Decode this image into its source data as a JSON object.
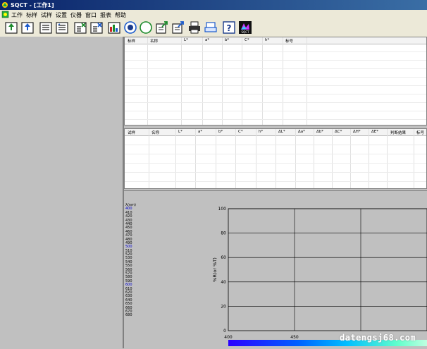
{
  "window": {
    "title": "SQCT - [工作1]"
  },
  "menu": [
    "工作",
    "标样",
    "试样",
    "设置",
    "仪器",
    "窗口",
    "报表",
    "帮助"
  ],
  "toolbar": {
    "buttons": [
      "doc-upload",
      "doc-upload-2",
      "doc-list",
      "doc-list-2",
      "doc-close",
      "doc-close-2",
      "bar-chart",
      "radio-on",
      "radio-off",
      "export",
      "export-2",
      "printer",
      "print-preview",
      "help",
      "sqct-logo"
    ],
    "logo_label": "SQCT"
  },
  "standard_table": {
    "columns": [
      "标样",
      "名称",
      "L*",
      "a*",
      "b*",
      "C*",
      "h*",
      "标号"
    ]
  },
  "sample_table": {
    "columns": [
      "试样",
      "名称",
      "L*",
      "a*",
      "b*",
      "C*",
      "h*",
      "ΔL*",
      "Δa*",
      "Δb*",
      "ΔC*",
      "ΔH*",
      "ΔE*",
      "判断结果",
      "标号"
    ]
  },
  "wavelengths": {
    "header": "λ(nm)",
    "items": [
      "400",
      "410",
      "420",
      "430",
      "440",
      "450",
      "460",
      "470",
      "480",
      "490",
      "500",
      "510",
      "520",
      "530",
      "540",
      "550",
      "560",
      "570",
      "580",
      "590",
      "600",
      "610",
      "620",
      "630",
      "640",
      "650",
      "660",
      "670",
      "680"
    ],
    "highlight": [
      "400",
      "500",
      "600"
    ],
    "highlight_color": "#0000cc"
  },
  "chart_data": {
    "type": "line",
    "ylabel": "%R(or %T)",
    "xlabel": "",
    "ylim": [
      0,
      100
    ],
    "yticks": [
      0,
      20,
      40,
      60,
      80,
      100
    ],
    "xlim": [
      400,
      500
    ],
    "xticks": [
      400,
      450
    ],
    "grid": true,
    "series": []
  },
  "watermark": "datengsj68.com",
  "colors": {
    "title_bar": "#0a246a",
    "panel": "#c0c0c0",
    "accent": "#0000cc"
  }
}
